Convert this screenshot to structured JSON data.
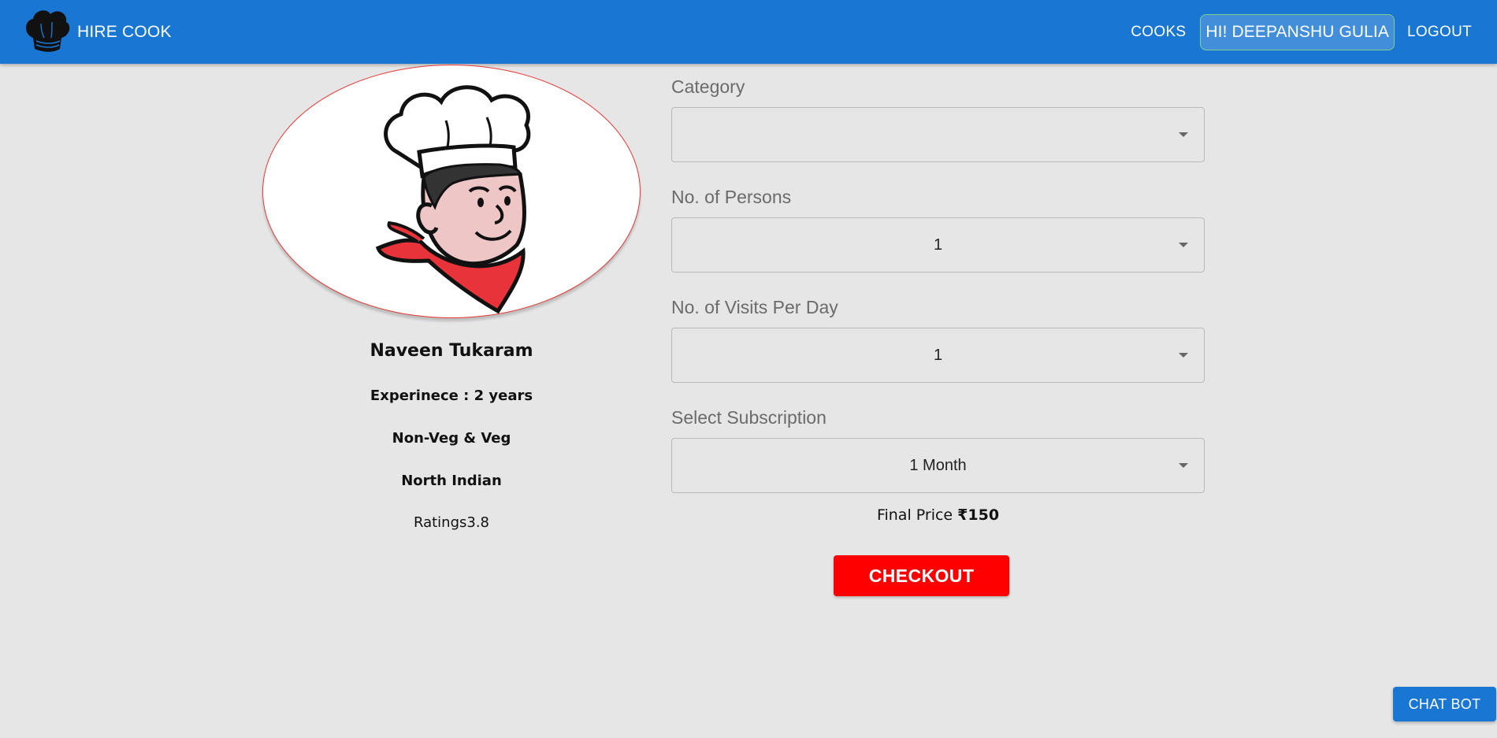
{
  "header": {
    "brand": "HIRE COOK",
    "brand_icon": "chef-hat-icon",
    "nav": {
      "cooks": "COOKS",
      "user": "HI! DEEPANSHU GULIA",
      "logout": "LOGOUT"
    }
  },
  "cook": {
    "image": "chef-illustration",
    "name": "Naveen Tukaram",
    "experience": "Experinece : 2 years",
    "food_type": "Non-Veg & Veg",
    "cuisine": "North Indian",
    "rating": "Ratings3.8"
  },
  "form": {
    "category": {
      "label": "Category",
      "value": ""
    },
    "persons": {
      "label": "No. of Persons",
      "value": "1"
    },
    "visits": {
      "label": "No. of Visits Per Day",
      "value": "1"
    },
    "subscription": {
      "label": "Select Subscription",
      "value": "1 Month"
    },
    "final_price_label": "Final Price ",
    "final_price_value": "₹150",
    "checkout": "CHECKOUT"
  },
  "chatbot": "CHAT BOT",
  "colors": {
    "appbar": "#1976d2",
    "background": "#e6e6e6",
    "checkout": "#ff0000",
    "avatar_border": "#e53935"
  }
}
